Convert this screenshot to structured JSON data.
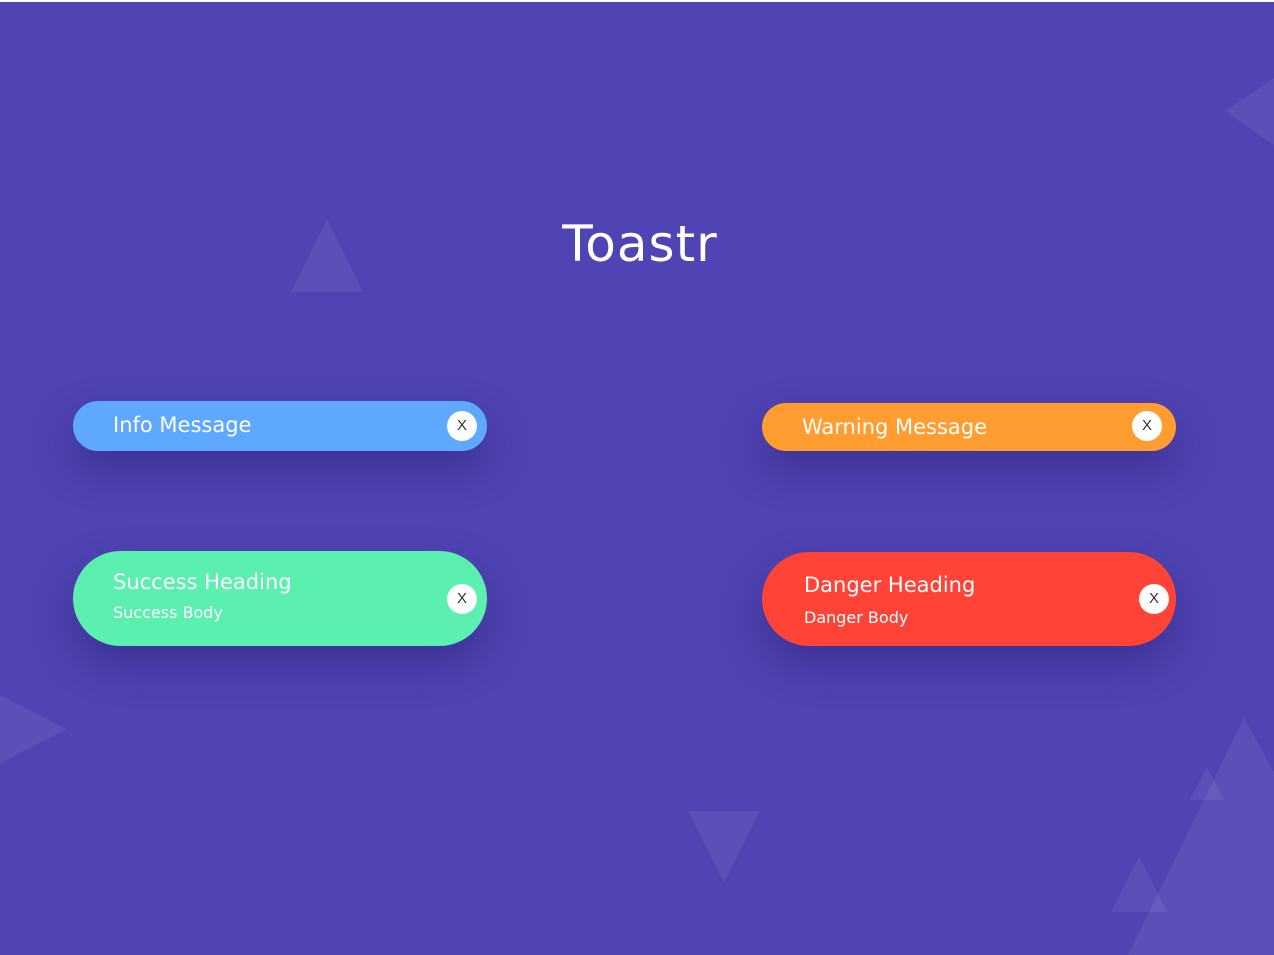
{
  "page": {
    "title": "Toastr",
    "background_color": "#5043b3"
  },
  "toasts": {
    "info": {
      "text": "Info Message",
      "color": "#5ea8ff",
      "close_label": "X"
    },
    "warning": {
      "text": "Warning Message",
      "color": "#ff9d31",
      "close_label": "X"
    },
    "success": {
      "heading": "Success Heading",
      "body": "Success Body",
      "color": "#5bf0b0",
      "close_label": "X"
    },
    "danger": {
      "heading": "Danger Heading",
      "body": "Danger Body",
      "color": "#ff4437",
      "close_label": "X"
    }
  }
}
